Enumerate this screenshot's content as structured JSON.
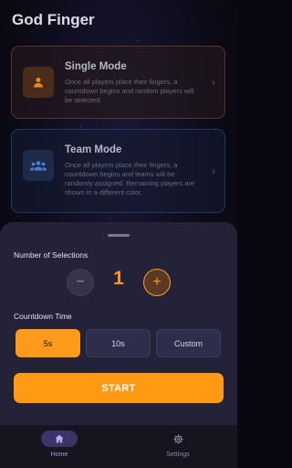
{
  "app": {
    "title": "God Finger"
  },
  "modes": [
    {
      "title": "Single Mode",
      "description": "Once all players place their fingers, a countdown begins and random players will be selected.",
      "icon": "person-icon"
    },
    {
      "title": "Team Mode",
      "description": "Once all players place their fingers, a countdown begins and teams will be randomly assigned. Remaining players are shown in a different color.",
      "icon": "group-icon"
    }
  ],
  "sheet": {
    "selections_label": "Number of Selections",
    "minus_symbol": "−",
    "plus_symbol": "+",
    "selection_count": "1",
    "countdown_label": "Countdown Time",
    "countdown_options": [
      "5s",
      "10s",
      "Custom"
    ],
    "selected_countdown": "5s",
    "start_label": "START"
  },
  "nav": {
    "items": [
      {
        "label": "Home",
        "icon": "home-icon",
        "active": true
      },
      {
        "label": "Settings",
        "icon": "gear-icon",
        "active": false
      }
    ]
  },
  "colors": {
    "accent": "#ff9a12",
    "sheet": "#242238",
    "nav_active": "#a39de8"
  }
}
